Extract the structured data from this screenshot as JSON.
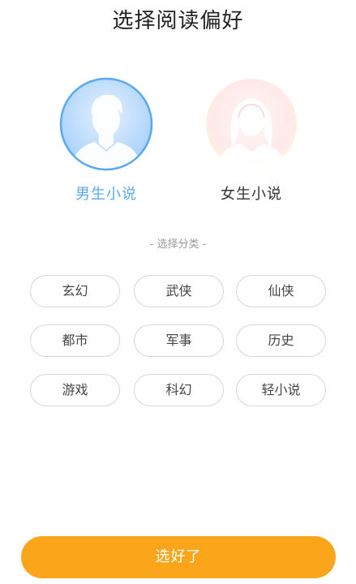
{
  "page": {
    "title": "选择阅读偏好"
  },
  "genders": [
    {
      "label": "男生小说",
      "selected": true,
      "icon": "male-avatar-icon"
    },
    {
      "label": "女生小说",
      "selected": false,
      "icon": "female-avatar-icon"
    }
  ],
  "categories": {
    "title": "- 选择分类 -",
    "items": [
      "玄幻",
      "武侠",
      "仙侠",
      "都市",
      "军事",
      "历史",
      "游戏",
      "科幻",
      "轻小说"
    ]
  },
  "confirm": {
    "label": "选好了"
  },
  "colors": {
    "accent_blue": "#5aa9f0",
    "button_orange": "#fba51a",
    "chip_border": "#d6d6d6"
  }
}
